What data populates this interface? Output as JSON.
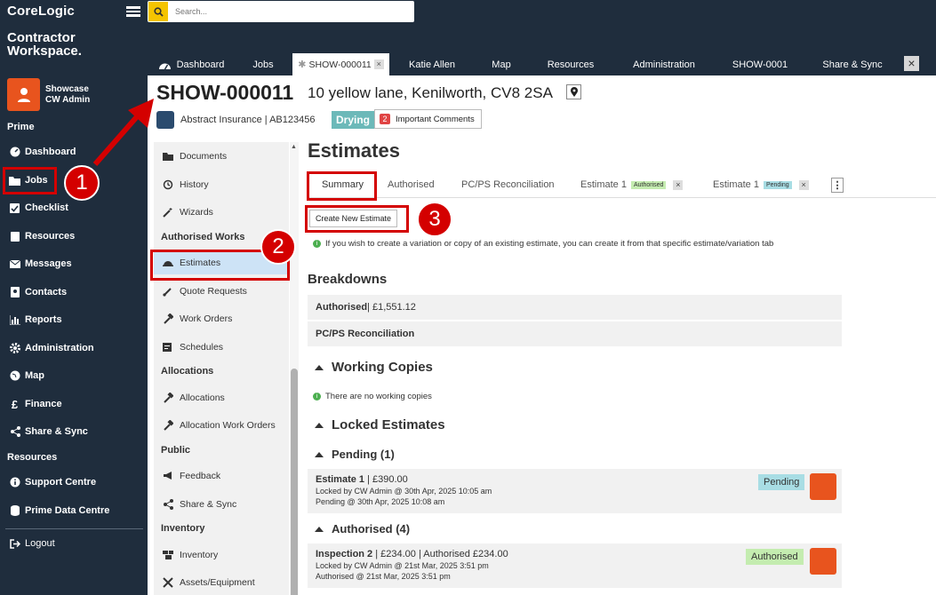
{
  "app": {
    "brand": "CoreLogic",
    "brand_sub_1": "Contractor",
    "brand_sub_2": "Workspace."
  },
  "user": {
    "name": "Showcase",
    "role": "CW Admin"
  },
  "sidebar": {
    "section_prime": "Prime",
    "section_resources": "Resources",
    "items": [
      {
        "label": "Dashboard",
        "icon": "dashboard-icon"
      },
      {
        "label": "Jobs",
        "icon": "folder-icon"
      },
      {
        "label": "Checklist",
        "icon": "checkbox-icon"
      },
      {
        "label": "Resources",
        "icon": "clipboard-icon"
      },
      {
        "label": "Messages",
        "icon": "envelope-icon"
      },
      {
        "label": "Contacts",
        "icon": "contact-card-icon"
      },
      {
        "label": "Reports",
        "icon": "chart-icon"
      },
      {
        "label": "Administration",
        "icon": "gear-icon"
      },
      {
        "label": "Map",
        "icon": "globe-icon"
      },
      {
        "label": "Finance",
        "icon": "pound-icon"
      },
      {
        "label": "Share & Sync",
        "icon": "share-icon"
      }
    ],
    "resource_items": [
      {
        "label": "Support Centre",
        "icon": "info-icon"
      },
      {
        "label": "Prime Data Centre",
        "icon": "database-icon"
      }
    ],
    "logout": "Logout"
  },
  "search": {
    "placeholder": "Search..."
  },
  "tabs": [
    {
      "label": "Dashboard"
    },
    {
      "label": "Jobs"
    },
    {
      "label": "SHOW-000011"
    },
    {
      "label": "Katie Allen"
    },
    {
      "label": "Map"
    },
    {
      "label": "Resources"
    },
    {
      "label": "Administration"
    },
    {
      "label": "SHOW-0001"
    },
    {
      "label": "Share & Sync"
    }
  ],
  "job": {
    "id": "SHOW-000011",
    "address": "10 yellow lane, Kenilworth, CV8 2SA",
    "insurer": "Abstract Insurance | AB123456",
    "status": "Drying",
    "important_count": "2",
    "important_label": "Important Comments"
  },
  "submenu": {
    "items_top": [
      "Documents",
      "History",
      "Wizards"
    ],
    "head_authorised": "Authorised Works",
    "items_authorised": [
      "Estimates",
      "Quote Requests",
      "Work Orders",
      "Schedules"
    ],
    "head_allocations": "Allocations",
    "items_allocations": [
      "Allocations",
      "Allocation Work Orders"
    ],
    "head_public": "Public",
    "items_public": [
      "Feedback",
      "Share & Sync"
    ],
    "head_inventory": "Inventory",
    "items_inventory": [
      "Inventory",
      "Assets/Equipment"
    ]
  },
  "estimates": {
    "title": "Estimates",
    "tabs": [
      "Summary",
      "Authorised",
      "PC/PS Reconciliation",
      "Estimate 1",
      "Estimate 1"
    ],
    "tab_tags": [
      "Authorised",
      "Pending"
    ],
    "create_label": "Create New Estimate",
    "info_text": "If you wish to create a variation or copy of an existing estimate, you can create it from that specific estimate/variation tab",
    "breakdowns_title": "Breakdowns",
    "breakdown_authorised_label": "Authorised",
    "breakdown_authorised_value": " | £1,551.12",
    "breakdown_pcps": "PC/PS Reconciliation",
    "working_copies_title": "Working Copies",
    "no_working_copies": "There are no working copies",
    "locked_title": "Locked Estimates",
    "pending_head": "Pending (1)",
    "authorised_head": "Authorised (4)",
    "pending_card": {
      "name": "Estimate 1",
      "amount": " | £390.00",
      "locked": "Locked by CW Admin @ 30th Apr, 2025 10:05 am",
      "status_line": "Pending @ 30th Apr, 2025 10:08 am",
      "badge": "Pending"
    },
    "authorised_card": {
      "name": "Inspection 2",
      "amount": " | £234.00 | Authorised £234.00",
      "locked": "Locked by CW Admin @ 21st Mar, 2025 3:51 pm",
      "status_line": "Authorised @ 21st Mar, 2025 3:51 pm",
      "badge": "Authorised"
    }
  },
  "annotations": [
    "1",
    "2",
    "3"
  ],
  "colors": {
    "sidebar": "#1f2d3d",
    "accent": "#e8541e",
    "annotation": "#d40000",
    "search": "#f5c400",
    "drying": "#6cb9b9",
    "pending": "#a8dde4",
    "authorised": "#c4ecb0"
  }
}
